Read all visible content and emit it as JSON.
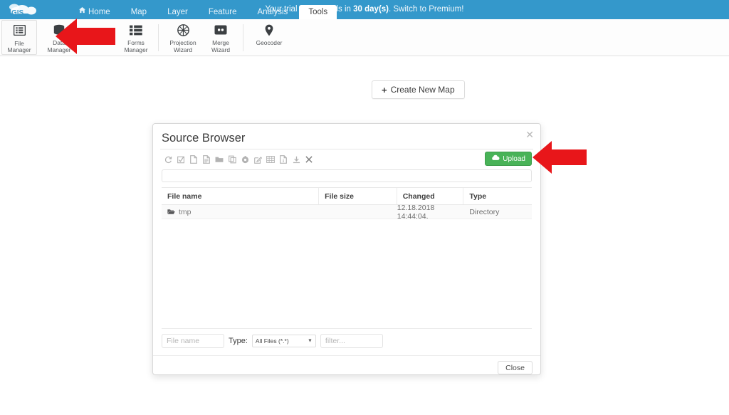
{
  "topbar": {
    "logo_text": "GIS",
    "logo_icon": "cloud-icon",
    "trial_message_prefix": "Your trial period ends in ",
    "trial_message_days": "30 day(s)",
    "trial_message_suffix": ". Switch to Premium!",
    "tabs": [
      {
        "label": "Home",
        "icon": "home-icon",
        "active": false
      },
      {
        "label": "Map",
        "icon": "",
        "active": false
      },
      {
        "label": "Layer",
        "icon": "",
        "active": false
      },
      {
        "label": "Feature",
        "icon": "",
        "active": false
      },
      {
        "label": "Analysis",
        "icon": "",
        "active": false
      },
      {
        "label": "Tools",
        "icon": "",
        "active": true
      }
    ],
    "accent_color": "#3498cb"
  },
  "ribbon": {
    "items": [
      {
        "label_line1": "File",
        "label_line2": "Manager",
        "icon": "file-manager-icon"
      },
      {
        "label_line1": "Data",
        "label_line2": "Manager",
        "icon": "data-manager-icon"
      },
      {
        "label_line1": "Forms",
        "label_line2": "Manager",
        "icon": "forms-manager-icon"
      },
      {
        "label_line1": "Projection",
        "label_line2": "Wizard",
        "icon": "projection-wizard-icon"
      },
      {
        "label_line1": "Merge",
        "label_line2": "Wizard",
        "icon": "merge-wizard-icon"
      },
      {
        "label_line1": "Geocoder",
        "label_line2": "",
        "icon": "geocoder-pin-icon"
      }
    ]
  },
  "main": {
    "create_map_label": "Create New Map",
    "create_map_icon": "plus-icon"
  },
  "dialog": {
    "title": "Source Browser",
    "close_icon": "close-icon",
    "toolbar_icons": [
      "refresh-icon",
      "select-all-icon",
      "new-file-icon",
      "new-text-file-icon",
      "new-folder-icon",
      "copy-icon",
      "settings-gear-icon",
      "rename-edit-icon",
      "grid-view-icon",
      "file-properties-icon",
      "download-icon",
      "delete-close-icon"
    ],
    "upload_label": "Upload",
    "upload_icon": "cloud-upload-icon",
    "upload_color": "#49b358",
    "path_value": "",
    "table": {
      "headers": [
        "File name",
        "File size",
        "Changed",
        "Type"
      ],
      "rows": [
        {
          "icon": "folder-open-icon",
          "name": "tmp",
          "size": "",
          "changed": "12.18.2018 14:44:04.",
          "type": "Directory"
        }
      ]
    },
    "footer": {
      "filename_placeholder": "File name",
      "filename_value": "",
      "type_label": "Type:",
      "type_selected": "All Files (*.*)",
      "type_options": [
        "All Files (*.*)"
      ],
      "filter_placeholder": "filter...",
      "filter_value": "",
      "close_label": "Close"
    }
  },
  "annotations": {
    "arrow_color": "#e8161a",
    "arrows": [
      {
        "name": "ribbon-pointer-arrow",
        "direction": "left"
      },
      {
        "name": "upload-pointer-arrow",
        "direction": "left"
      }
    ]
  }
}
